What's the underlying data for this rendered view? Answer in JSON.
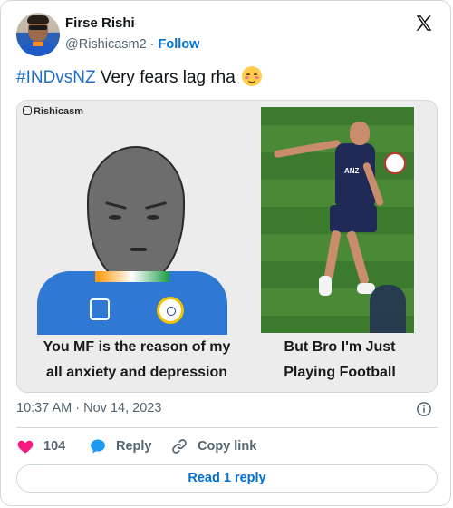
{
  "author": {
    "name": "Firse Rishi",
    "handle": "@Rishicasm2",
    "separator": "·",
    "follow_label": "Follow"
  },
  "tweet": {
    "hashtag": "#INDvsNZ",
    "text": " Very fears lag rha",
    "emoji": "smiling-face-with-blush"
  },
  "media": {
    "watermark": "Rishicasm",
    "left_caption_line1": "You MF is the reason of my",
    "left_caption_line2": "all anxiety and depression",
    "right_caption_line1": "But Bro I'm Just",
    "right_caption_line2": "Playing Football",
    "jersey_text": "ANZ"
  },
  "meta": {
    "timestamp": "10:37 AM · Nov 14, 2023"
  },
  "actions": {
    "like_count": "104",
    "reply_label": "Reply",
    "copy_label": "Copy link"
  },
  "footer": {
    "read_replies_label": "Read 1 reply"
  },
  "colors": {
    "link": "#006fd6",
    "hashtag": "#1d70c9",
    "heart": "#f91880",
    "reply_bubble": "#1d9bf0",
    "muted": "#536471"
  },
  "icons": {
    "platform": "x-logo-icon",
    "like": "heart-icon",
    "reply": "speech-bubble-icon",
    "copy": "link-icon",
    "info": "info-icon"
  }
}
